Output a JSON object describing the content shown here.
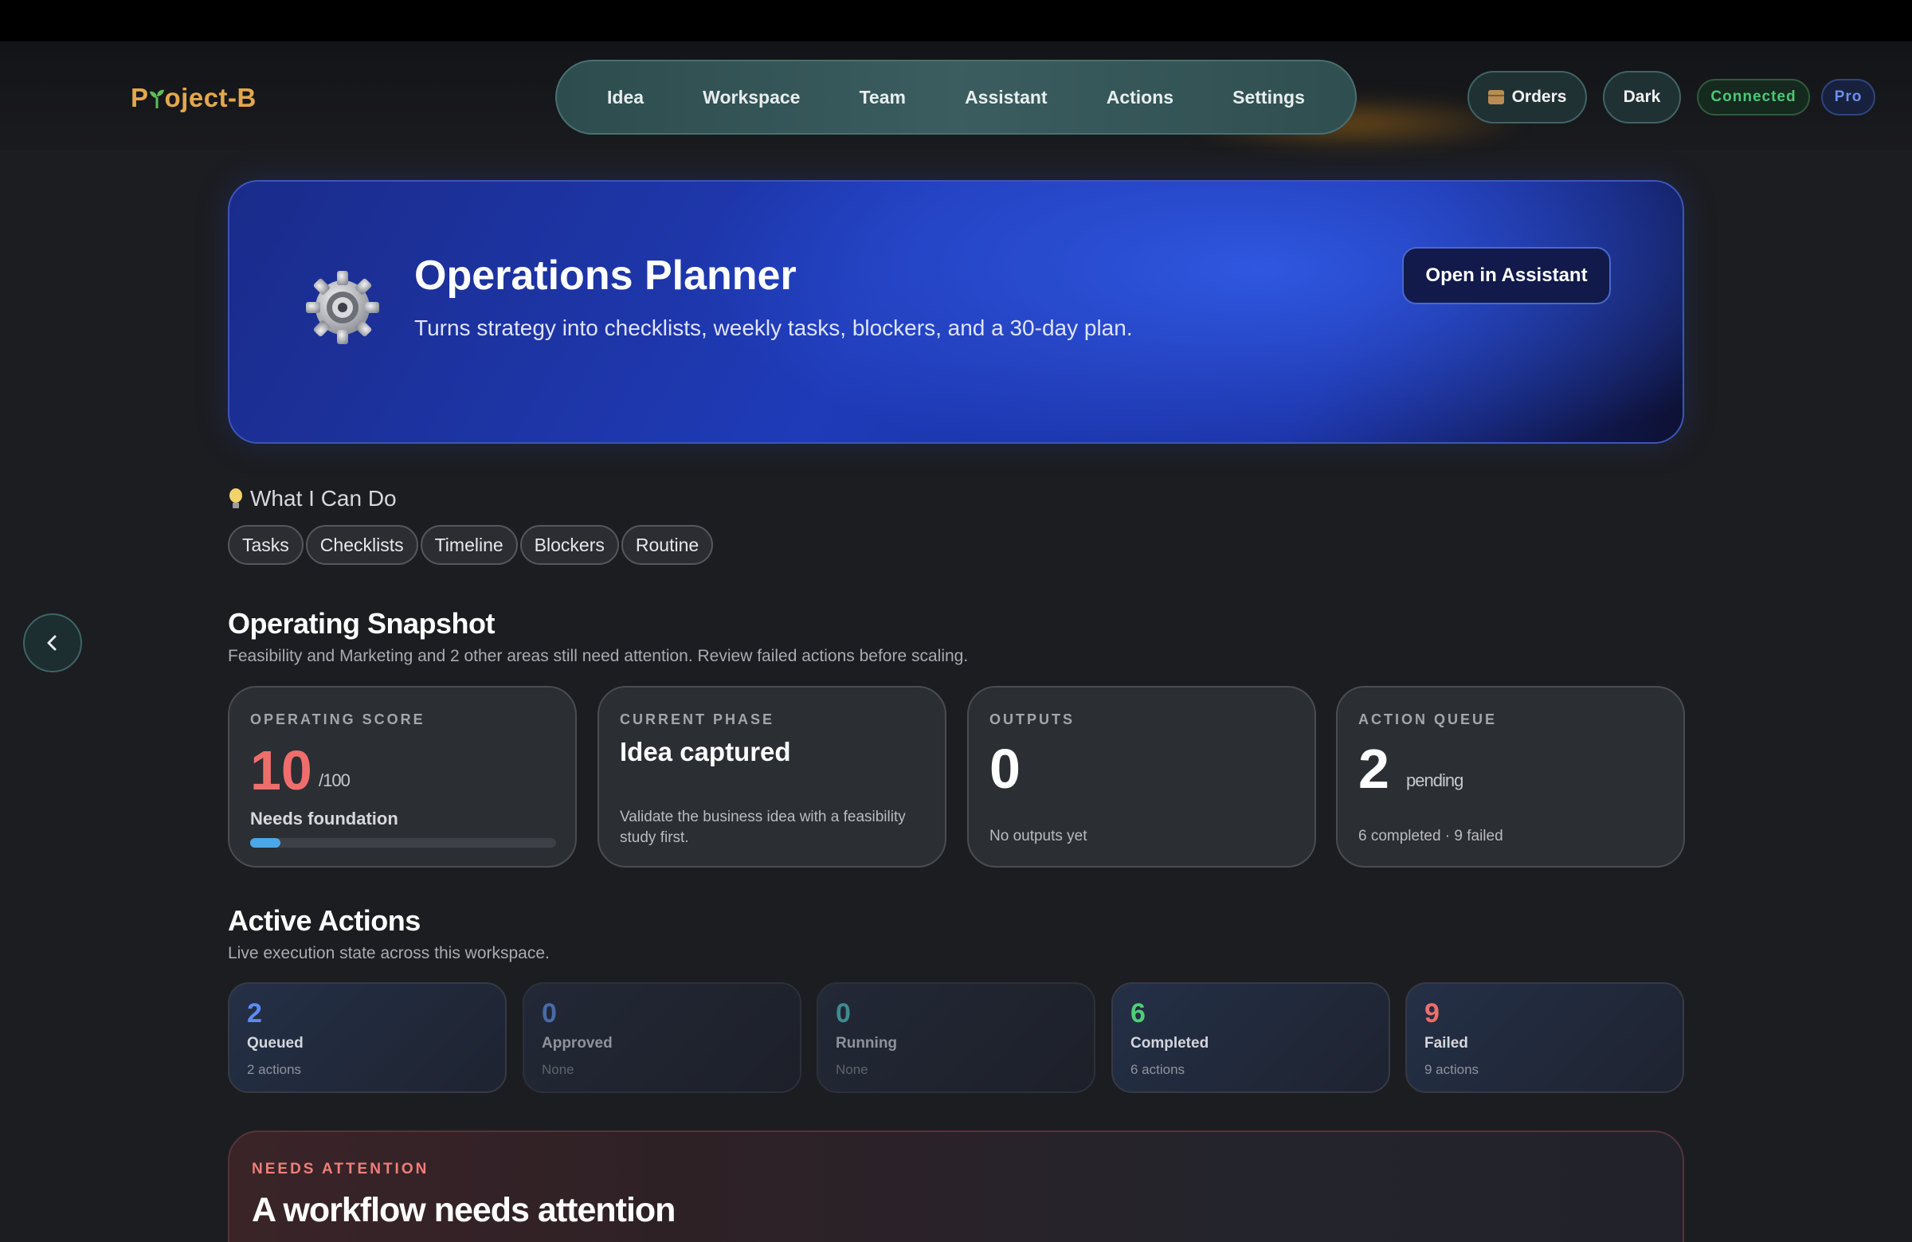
{
  "header": {
    "logo": {
      "p": "P",
      "rest": "oject-B"
    },
    "nav": [
      "Idea",
      "Workspace",
      "Team",
      "Assistant",
      "Actions",
      "Settings"
    ],
    "orders_label": "Orders",
    "theme_label": "Dark",
    "status_badge": "Connected",
    "plan_badge": "Pro"
  },
  "hero": {
    "title": "Operations Planner",
    "subtitle": "Turns strategy into checklists, weekly tasks, blockers, and a 30-day plan.",
    "cta": "Open in Assistant",
    "icon": "gear-icon"
  },
  "capabilities": {
    "heading": "What I Can Do",
    "chips": [
      "Tasks",
      "Checklists",
      "Timeline",
      "Blockers",
      "Routine"
    ]
  },
  "snapshot": {
    "title": "Operating Snapshot",
    "subtitle": "Feasibility and Marketing and 2 other areas still need attention. Review failed actions before scaling.",
    "score": {
      "label": "OPERATING SCORE",
      "value": "10",
      "max": "/100",
      "status": "Needs foundation",
      "progress": 0.1
    },
    "phase": {
      "label": "CURRENT PHASE",
      "value": "Idea captured",
      "description": "Validate the business idea with a feasibility study first."
    },
    "outputs": {
      "label": "OUTPUTS",
      "value": "0",
      "footer": "No outputs yet"
    },
    "queue": {
      "label": "ACTION QUEUE",
      "value": "2",
      "unit": "pending",
      "footer": "6 completed · 9 failed"
    }
  },
  "active_actions": {
    "title": "Active Actions",
    "subtitle": "Live execution state across this workspace.",
    "stats": [
      {
        "value": "2",
        "label": "Queued",
        "sub": "2 actions",
        "color": "#5b8cf0"
      },
      {
        "value": "0",
        "label": "Approved",
        "sub": "None",
        "color": "#4a6aa8"
      },
      {
        "value": "0",
        "label": "Running",
        "sub": "None",
        "color": "#3f8a92"
      },
      {
        "value": "6",
        "label": "Completed",
        "sub": "6 actions",
        "color": "#4fcf74"
      },
      {
        "value": "9",
        "label": "Failed",
        "sub": "9 actions",
        "color": "#ef6e6b"
      }
    ]
  },
  "attention": {
    "label": "NEEDS ATTENTION",
    "title": "A workflow needs attention"
  },
  "colors": {
    "accent_logo": "#e3a84a",
    "hero_blue": "#1f3bb8",
    "score_red": "#ef6e6b",
    "progress_blue": "#4aa8e8"
  }
}
